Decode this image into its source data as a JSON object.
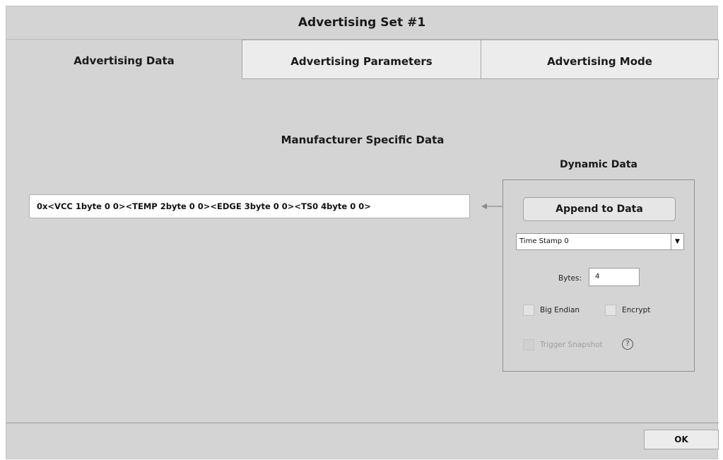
{
  "window": {
    "title": "Advertising Set #1"
  },
  "tabs": [
    {
      "label": "Advertising Data",
      "active": true
    },
    {
      "label": "Advertising Parameters",
      "active": false
    },
    {
      "label": "Advertising Mode",
      "active": false
    }
  ],
  "main": {
    "section_title": "Manufacturer Specific Data",
    "data_value": "0x<VCC 1byte 0 0><TEMP 2byte 0 0><EDGE 3byte 0 0><TS0 4byte 0 0>"
  },
  "dynamic": {
    "title": "Dynamic Data",
    "append_label": "Append to Data",
    "select_value": "Time Stamp 0",
    "bytes_label": "Bytes:",
    "bytes_value": "4",
    "big_endian_label": "Big Endian",
    "encrypt_label": "Encrypt",
    "trigger_label": "Trigger Snapshot",
    "help_symbol": "?"
  },
  "footer": {
    "ok_label": "OK"
  },
  "icons": {
    "arrow": "arrow-left-icon",
    "caret": "caret-down-icon",
    "help": "help-icon"
  }
}
